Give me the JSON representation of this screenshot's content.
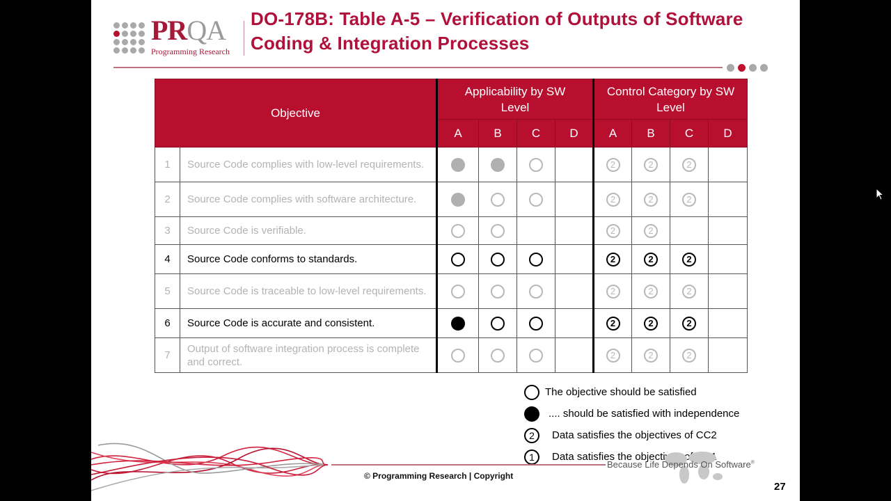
{
  "slide": {
    "logo": {
      "brand_primary": "PR",
      "brand_secondary": "QA",
      "subtitle": "Programming Research"
    },
    "title_line1": "DO-178B: Table A-5 – Verification of Outputs of Software",
    "title_line2": "Coding & Integration Processes",
    "pager": {
      "total": 4,
      "active_index": 1
    },
    "table": {
      "header": {
        "objective": "Objective",
        "applicability": "Applicability by SW Level",
        "control_category": "Control Category by SW Level",
        "levels": [
          "A",
          "B",
          "C",
          "D"
        ]
      },
      "rows": [
        {
          "num": "1",
          "text": "Source Code complies with low-level requirements.",
          "state": "dim",
          "applicability": [
            "filled",
            "filled",
            "open",
            ""
          ],
          "control": [
            "2",
            "2",
            "2",
            ""
          ]
        },
        {
          "num": "2",
          "text": "Source Code complies with software architecture.",
          "state": "dim",
          "applicability": [
            "filled",
            "open",
            "open",
            ""
          ],
          "control": [
            "2",
            "2",
            "2",
            ""
          ]
        },
        {
          "num": "3",
          "text": "Source Code is verifiable.",
          "state": "dim",
          "applicability": [
            "open",
            "open",
            "",
            ""
          ],
          "control": [
            "2",
            "2",
            "",
            ""
          ]
        },
        {
          "num": "4",
          "text": "Source Code conforms to standards.",
          "state": "active",
          "applicability": [
            "open",
            "open",
            "open",
            ""
          ],
          "control": [
            "2",
            "2",
            "2",
            ""
          ]
        },
        {
          "num": "5",
          "text": "Source Code is traceable to low-level requirements.",
          "state": "dim",
          "applicability": [
            "open",
            "open",
            "open",
            ""
          ],
          "control": [
            "2",
            "2",
            "2",
            ""
          ]
        },
        {
          "num": "6",
          "text": "Source Code is accurate and consistent.",
          "state": "active",
          "applicability": [
            "filled",
            "open",
            "open",
            ""
          ],
          "control": [
            "2",
            "2",
            "2",
            ""
          ]
        },
        {
          "num": "7",
          "text": "Output of software integration process is complete and correct.",
          "state": "dim",
          "applicability": [
            "open",
            "open",
            "open",
            ""
          ],
          "control": [
            "2",
            "2",
            "2",
            ""
          ]
        }
      ]
    },
    "legend": [
      {
        "symbol": "open",
        "label": "The objective should be satisfied"
      },
      {
        "symbol": "filled",
        "label": ".... should be satisfied with independence"
      },
      {
        "symbol": "2",
        "label": "Data satisfies the objectives of CC2"
      },
      {
        "symbol": "1",
        "label": "Data satisfies the objectives of CC1"
      }
    ],
    "tagline": "Because Life Depends On Software",
    "tagline_mark": "®",
    "copyright": "© Programming Research | Copyright",
    "page_number": "27"
  },
  "colors": {
    "brand_red": "#b90f2f",
    "title_red": "#b0103a",
    "dim_gray": "#b3b3b3"
  }
}
